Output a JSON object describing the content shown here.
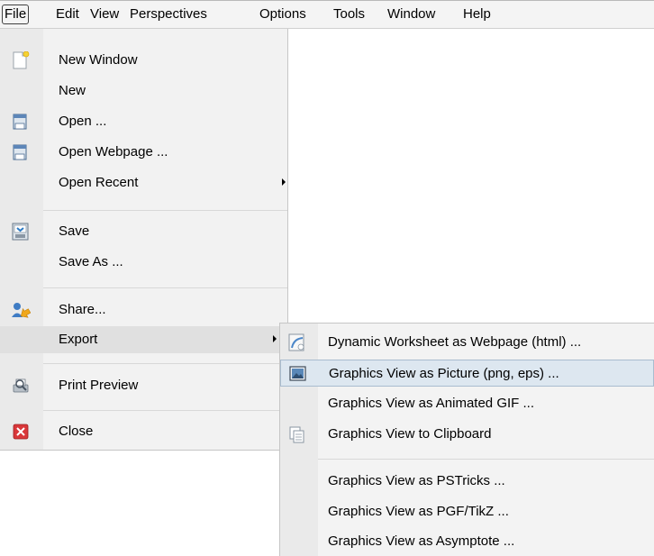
{
  "menubar": {
    "items": [
      "File",
      "Edit",
      "View",
      "Perspectives",
      "Options",
      "Tools",
      "Window",
      "Help"
    ]
  },
  "file_menu": {
    "items": {
      "new_window": "New Window",
      "new": "New",
      "open": "Open ...",
      "open_webpage": "Open Webpage ...",
      "open_recent": "Open Recent",
      "save": "Save",
      "save_as": "Save As ...",
      "share": "Share...",
      "export": "Export",
      "print_preview": "Print Preview",
      "close": "Close"
    }
  },
  "export_submenu": {
    "items": {
      "dynamic_worksheet": "Dynamic Worksheet as Webpage (html) ...",
      "graphics_picture": "Graphics View as Picture (png, eps) ...",
      "graphics_gif": "Graphics View as Animated GIF ...",
      "graphics_clipboard": "Graphics View to Clipboard",
      "graphics_pstricks": "Graphics View as PSTricks ...",
      "graphics_pgf": "Graphics View as PGF/TikZ ...",
      "graphics_asymptote": "Graphics View as Asymptote ..."
    }
  },
  "icons": {
    "new_window": "new-document-icon",
    "open": "folder-icon",
    "open_webpage": "folder-icon",
    "save": "save-icon",
    "share": "share-icon",
    "print_preview": "print-preview-icon",
    "close": "close-icon",
    "dynamic_worksheet": "webpage-icon",
    "graphics_picture": "picture-icon",
    "graphics_clipboard": "clipboard-icon"
  },
  "colors": {
    "menu_bg": "#f2f2f2",
    "gutter_bg": "#eaeaea",
    "highlight": "#e0e0e0",
    "selected": "#dde7f0",
    "close_red": "#d9373a"
  }
}
